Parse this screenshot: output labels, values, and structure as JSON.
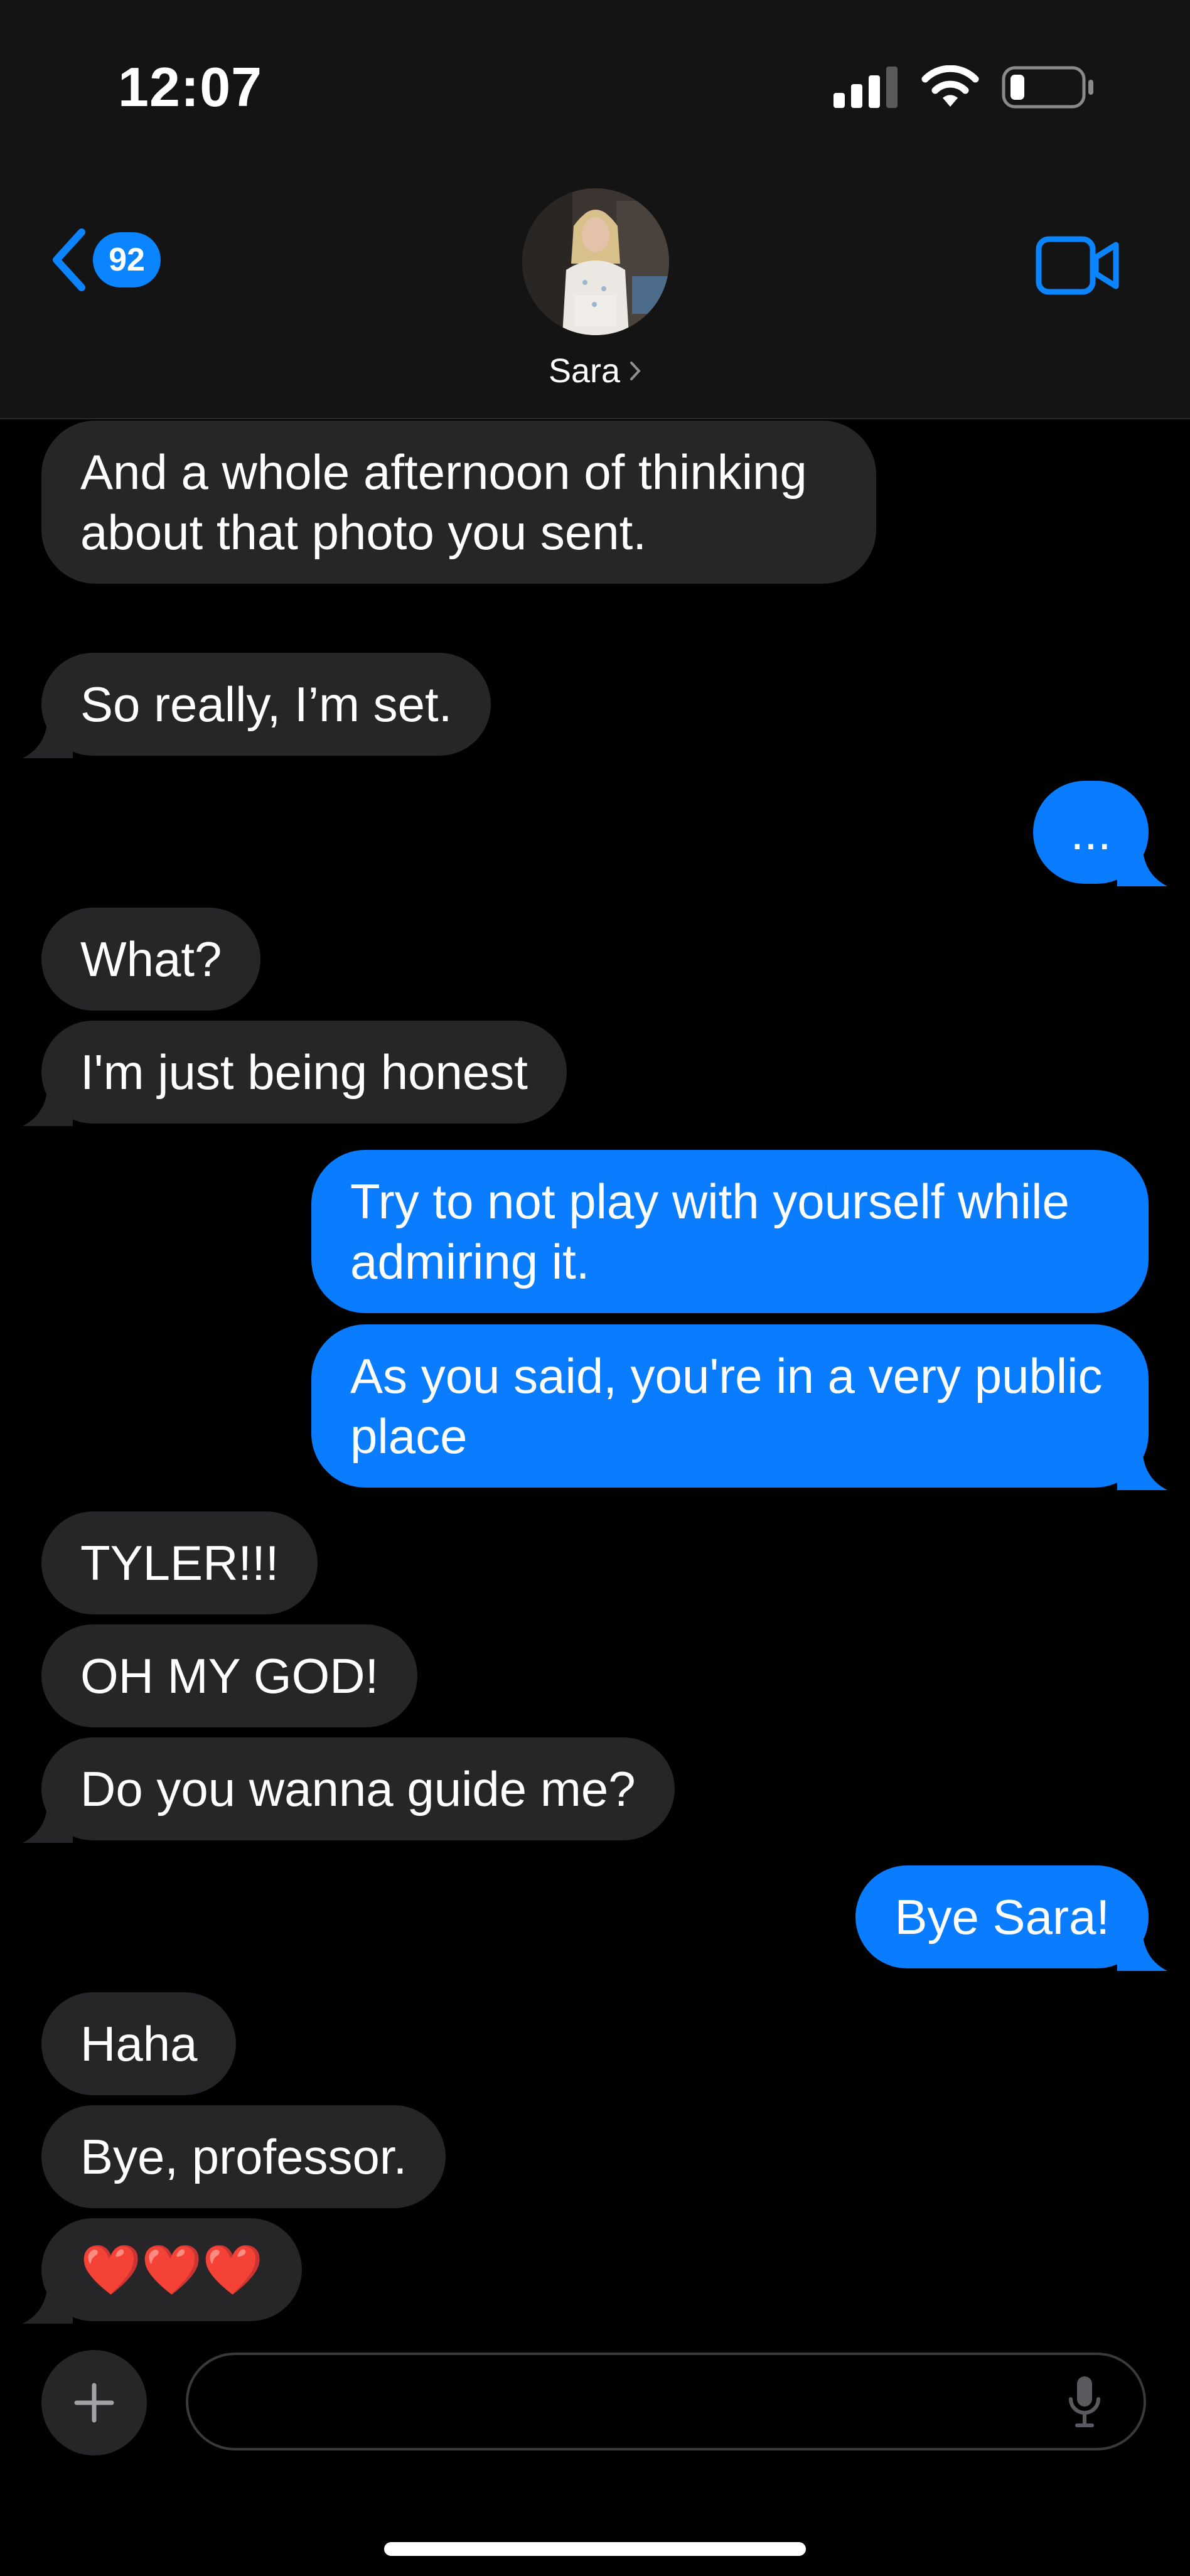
{
  "status_bar": {
    "time": "12:07"
  },
  "header": {
    "back_badge": "92",
    "contact_name": "Sara"
  },
  "messages": [
    {
      "from": "them",
      "text": "And a whole afternoon of thinking about that photo you sent."
    },
    {
      "from": "them",
      "text": "So really, I’m set."
    },
    {
      "from": "me",
      "text": "..."
    },
    {
      "from": "them",
      "text": "What?"
    },
    {
      "from": "them",
      "text": "I'm just being honest"
    },
    {
      "from": "me",
      "text": "Try to not play with yourself while admiring it."
    },
    {
      "from": "me",
      "text": "As you said, you're in a very public place"
    },
    {
      "from": "them",
      "text": "TYLER!!!"
    },
    {
      "from": "them",
      "text": "OH MY GOD!"
    },
    {
      "from": "them",
      "text": "Do you wanna guide me?"
    },
    {
      "from": "me",
      "text": "Bye Sara!"
    },
    {
      "from": "them",
      "text": "Haha"
    },
    {
      "from": "them",
      "text": "Bye, professor."
    },
    {
      "from": "them",
      "text": "❤️❤️❤️"
    }
  ],
  "input": {
    "placeholder": ""
  },
  "colors": {
    "accent": "#0a84ff",
    "outgoing": "#0a7cff",
    "incoming": "#262628",
    "background": "#000000"
  }
}
